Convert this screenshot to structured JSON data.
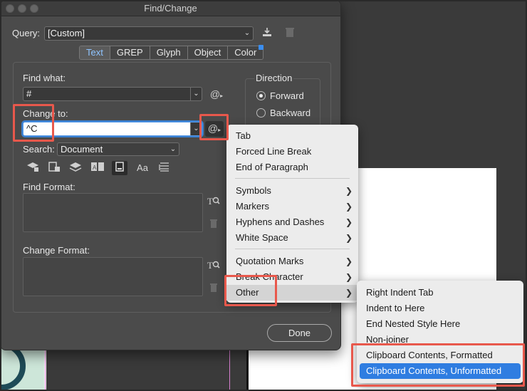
{
  "window": {
    "title": "Find/Change"
  },
  "query": {
    "label": "Query:",
    "value": "[Custom]"
  },
  "tabs": [
    {
      "label": "Text",
      "active": true
    },
    {
      "label": "GREP",
      "active": false
    },
    {
      "label": "Glyph",
      "active": false
    },
    {
      "label": "Object",
      "active": false
    },
    {
      "label": "Color",
      "active": false
    }
  ],
  "find_what": {
    "label": "Find what:",
    "value": "#"
  },
  "change_to": {
    "label": "Change to:",
    "value": "^C"
  },
  "search": {
    "label": "Search:",
    "value": "Document"
  },
  "direction": {
    "label": "Direction",
    "forward": "Forward",
    "backward": "Backward",
    "selected": "Forward"
  },
  "find_format": {
    "label": "Find Format:"
  },
  "change_format": {
    "label": "Change Format:"
  },
  "done_label": "Done",
  "special_char_icon": "@",
  "options_icons": [
    "lock-layers-icon",
    "lock-stories-icon",
    "hidden-layers-icon",
    "master-pages-icon",
    "footnotes-icon",
    "case-sensitive-icon",
    "whole-word-icon"
  ],
  "case_icon_text": "Aa",
  "menu": {
    "items": [
      {
        "label": "Tab",
        "submenu": false
      },
      {
        "label": "Forced Line Break",
        "submenu": false
      },
      {
        "label": "End of Paragraph",
        "submenu": false
      },
      {
        "label": "Symbols",
        "submenu": true
      },
      {
        "label": "Markers",
        "submenu": true
      },
      {
        "label": "Hyphens and Dashes",
        "submenu": true
      },
      {
        "label": "White Space",
        "submenu": true
      },
      {
        "label": "Quotation Marks",
        "submenu": true
      },
      {
        "label": "Break Character",
        "submenu": true
      },
      {
        "label": "Other",
        "submenu": true,
        "highlighted": true
      }
    ]
  },
  "submenu": {
    "items": [
      {
        "label": "Right Indent Tab"
      },
      {
        "label": "Indent to Here"
      },
      {
        "label": "End Nested Style Here"
      },
      {
        "label": "Non-joiner"
      },
      {
        "label": "Clipboard Contents, Formatted"
      },
      {
        "label": "Clipboard Contents, Unformatted",
        "selected": true
      }
    ]
  },
  "colors": {
    "dialog_bg": "#4b4b4b",
    "active_tab_text": "#8fc4ff",
    "highlight_box": "#e8584c",
    "menu_selection": "#2f7de1"
  }
}
